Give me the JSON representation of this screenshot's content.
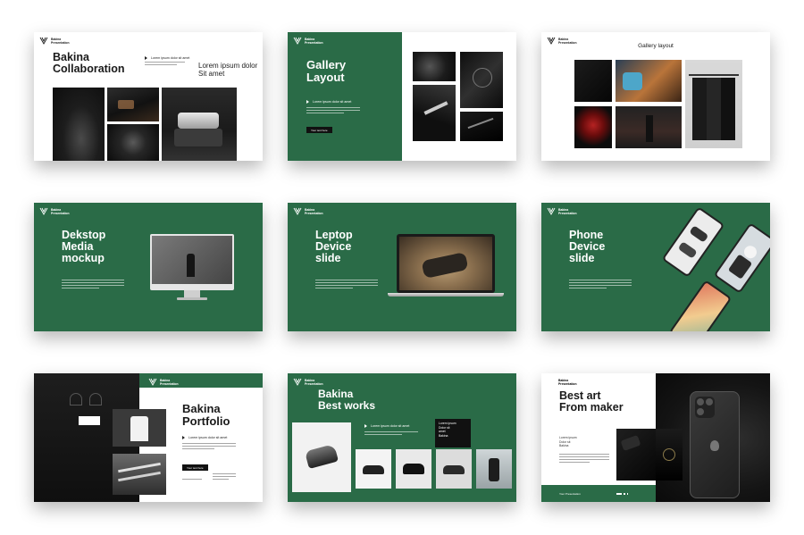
{
  "brand": {
    "name": "Bakina",
    "sub": "Presentation"
  },
  "colors": {
    "green": "#2a6b47",
    "dark": "#1a1a1a",
    "white": "#ffffff"
  },
  "slides": {
    "s1": {
      "title_l1": "Bakina",
      "title_l2": "Collaboration",
      "bullet": "Lorem ipsum dolor sit amet",
      "side_l1": "Lorem ipsum dolor",
      "side_l2": "Sit amet"
    },
    "s2": {
      "title_l1": "Gallery",
      "title_l2": "Layout",
      "bullet": "Lorem ipsum dolor sit amet",
      "button": "Your text here"
    },
    "s3": {
      "title": "Gallery layout"
    },
    "s4": {
      "title_l1": "Dekstop",
      "title_l2": "Media",
      "title_l3": "mockup"
    },
    "s5": {
      "title_l1": "Leptop",
      "title_l2": "Device",
      "title_l3": "slide"
    },
    "s6": {
      "title_l1": "Phone",
      "title_l2": "Device",
      "title_l3": "slide"
    },
    "s7": {
      "title_l1": "Bakina",
      "title_l2": "Portfolio",
      "bullet": "Lorem ipsum dolor sit amet",
      "button": "Your text here"
    },
    "s8": {
      "title_l1": "Bakina",
      "title_l2": "Best works",
      "bullet": "Lorem ipsum dolor sit amet",
      "box_l1": "Lorem ipsum",
      "box_l2": "Dolor sit",
      "box_l3": "amet",
      "box_l4": "Bakina"
    },
    "s9": {
      "title_l1": "Best art",
      "title_l2": "From maker",
      "sub_l1": "Lorem ipsum",
      "sub_l2": "Dolor sit",
      "sub_l3": "Bakina",
      "footer": "Your Presentation"
    }
  }
}
